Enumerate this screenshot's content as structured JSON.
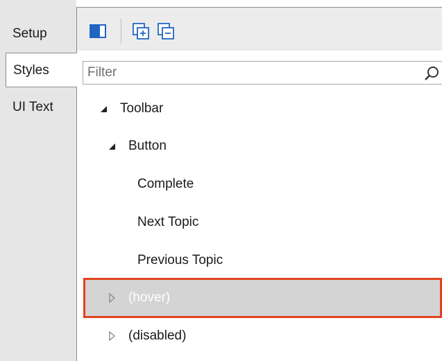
{
  "tabs": [
    {
      "label": "Setup"
    },
    {
      "label": "Styles"
    },
    {
      "label": "UI Text"
    }
  ],
  "filter": {
    "placeholder": "Filter",
    "value": ""
  },
  "tree": [
    {
      "label": "Toolbar",
      "level": 0,
      "expanded": true
    },
    {
      "label": "Button",
      "level": 1,
      "expanded": true
    },
    {
      "label": "Complete",
      "level": 2
    },
    {
      "label": "Next Topic",
      "level": 2
    },
    {
      "label": "Previous Topic",
      "level": 2
    },
    {
      "label": "(hover)",
      "level": 1,
      "expanded": false,
      "selected": true
    },
    {
      "label": "(disabled)",
      "level": 1,
      "expanded": false
    }
  ],
  "colors": {
    "selection_border": "#e2431e",
    "selection_fill": "#d4d4d4",
    "icon_blue": "#1f66c1"
  },
  "icons": {
    "panel_toggle": "panel-toggle-icon",
    "expand_all": "expand-all-icon",
    "collapse_all": "collapse-all-icon",
    "search": "search-icon"
  }
}
